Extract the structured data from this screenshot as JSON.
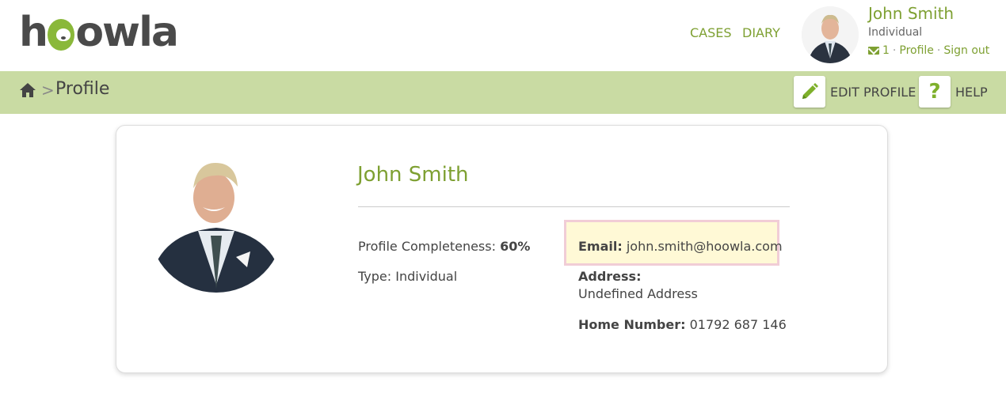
{
  "header": {
    "logo_text": "hoowla",
    "nav": [
      {
        "label": "CASES"
      },
      {
        "label": "DIARY"
      }
    ],
    "user": {
      "name": "John Smith",
      "type": "Individual",
      "message_count": "1",
      "profile_link": "Profile",
      "signout_link": "Sign out"
    }
  },
  "breadcrumb": {
    "separator": ">",
    "title": "Profile"
  },
  "toolbar": {
    "edit_label": "EDIT PROFILE",
    "help_label": "HELP",
    "help_glyph": "?"
  },
  "profile": {
    "name": "John Smith",
    "completeness_label": "Profile Completeness:",
    "completeness_value": "60%",
    "type_label": "Type:",
    "type_value": "Individual",
    "email_label": "Email:",
    "email_value": "john.smith@hoowla.com",
    "address_label": "Address:",
    "address_value": "Undefined Address",
    "phone_label": "Home Number:",
    "phone_value": "01792 687 146"
  },
  "colors": {
    "accent": "#7ea032",
    "crumbbar_bg": "#c9dba3",
    "email_highlight_bg": "#fff9d6",
    "email_highlight_border": "#f1cdd6"
  },
  "icons": [
    "home-icon",
    "mail-icon",
    "pencil-icon",
    "question-icon",
    "dog-logo-icon"
  ]
}
